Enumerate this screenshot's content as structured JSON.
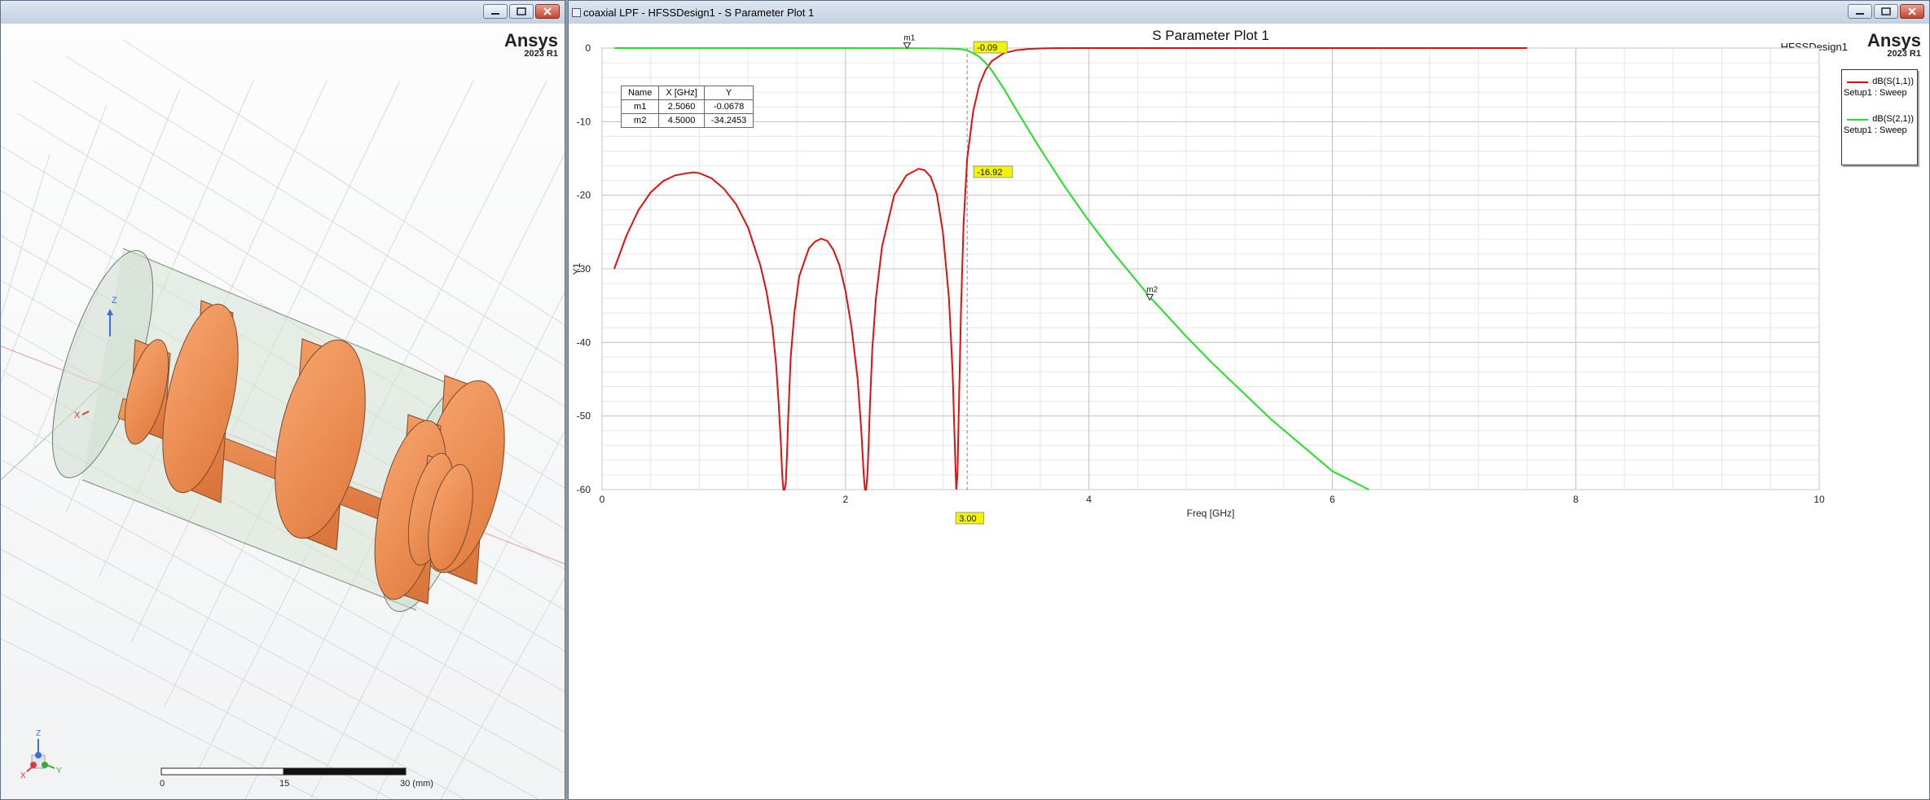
{
  "left_window": {
    "brand": "Ansys",
    "version": "2023 R1",
    "axis_triad": {
      "z": "Z",
      "x": "X",
      "y": "Y"
    },
    "scale_bar": {
      "labels": [
        "0",
        "15",
        "30 (mm)"
      ]
    },
    "model_axis_labels": {
      "z": "Z",
      "x": "X"
    },
    "colors": {
      "body": "#ef8c52",
      "air": "#d6e3d6",
      "grid": "#d0d4d8"
    }
  },
  "right_window": {
    "title": "coaxial LPF - HFSSDesign1 - S Parameter Plot 1",
    "brand": "Ansys",
    "version": "2023 R1",
    "design_name": "HFSSDesign1",
    "marker_table": {
      "headers": [
        "Name",
        "X [GHz]",
        "Y"
      ],
      "rows": [
        [
          "m1",
          "2.5060",
          "-0.0678"
        ],
        [
          "m2",
          "4.5000",
          "-34.2453"
        ]
      ]
    },
    "legend": [
      {
        "line1": "dB(S(1,1))",
        "line2": "Setup1 : Sweep",
        "color": "#e01010"
      },
      {
        "line1": "dB(S(2,1))",
        "line2": "Setup1 : Sweep",
        "color": "#22e022"
      }
    ],
    "cursor_labels": {
      "x_value": "3.00",
      "s21_value": "-0.09",
      "s11_value": "-16.92"
    },
    "markers": [
      {
        "name": "m1",
        "x": 2.506,
        "y": -0.0678
      },
      {
        "name": "m2",
        "x": 4.5,
        "y": -34.2453
      }
    ]
  },
  "chart_data": {
    "type": "line",
    "title": "S Parameter Plot 1",
    "xlabel": "Freq [GHz]",
    "ylabel": "Y1",
    "xlim": [
      0,
      10
    ],
    "ylim": [
      -60,
      0
    ],
    "xticks": [
      "0",
      "2",
      "4",
      "6",
      "8",
      "10"
    ],
    "yticks": [
      "0",
      "-10",
      "-20",
      "-30",
      "-40",
      "-50",
      "-60"
    ],
    "grid": true,
    "legend_position": "top-right",
    "series": [
      {
        "name": "dB(S(1,1))",
        "color": "#e01010",
        "x": [
          0.1,
          0.2,
          0.3,
          0.4,
          0.5,
          0.6,
          0.7,
          0.75,
          0.8,
          0.9,
          1.0,
          1.1,
          1.2,
          1.3,
          1.35,
          1.4,
          1.43,
          1.45,
          1.47,
          1.48,
          1.49,
          1.5,
          1.51,
          1.52,
          1.53,
          1.55,
          1.58,
          1.62,
          1.7,
          1.75,
          1.8,
          1.85,
          1.9,
          1.95,
          2.0,
          2.05,
          2.1,
          2.13,
          2.15,
          2.16,
          2.17,
          2.18,
          2.19,
          2.2,
          2.22,
          2.25,
          2.3,
          2.4,
          2.5,
          2.6,
          2.65,
          2.7,
          2.75,
          2.8,
          2.85,
          2.88,
          2.9,
          2.91,
          2.92,
          2.93,
          2.95,
          2.97,
          3.0,
          3.05,
          3.1,
          3.15,
          3.2,
          3.3,
          3.4,
          3.5,
          3.6,
          3.7,
          4.0,
          5.0,
          6.0,
          7.0,
          7.6
        ],
        "y": [
          -30,
          -25.5,
          -22,
          -19.6,
          -18.1,
          -17.3,
          -17.0,
          -16.9,
          -17.0,
          -17.7,
          -19.1,
          -21.2,
          -24.4,
          -29.5,
          -33,
          -38,
          -43,
          -48,
          -54,
          -58,
          -60,
          -60,
          -59,
          -55,
          -50,
          -42,
          -36,
          -31,
          -27.2,
          -26.3,
          -25.9,
          -26.2,
          -27.4,
          -29.5,
          -33,
          -38,
          -45,
          -52,
          -58,
          -60,
          -60,
          -58,
          -54,
          -49,
          -41,
          -34,
          -27,
          -20,
          -17.3,
          -16.4,
          -16.6,
          -17.5,
          -19.8,
          -25,
          -34,
          -44,
          -55,
          -60,
          -58,
          -50,
          -35,
          -24,
          -15,
          -8.5,
          -5,
          -3,
          -1.8,
          -0.7,
          -0.3,
          -0.12,
          -0.05,
          -0.02,
          0,
          0,
          0,
          0,
          0
        ]
      },
      {
        "name": "dB(S(2,1))",
        "color": "#22e022",
        "x": [
          0.1,
          1.0,
          2.0,
          2.5,
          2.8,
          2.9,
          2.95,
          3.0,
          3.05,
          3.1,
          3.15,
          3.2,
          3.3,
          3.4,
          3.5,
          3.6,
          3.8,
          4.0,
          4.2,
          4.5,
          4.8,
          5.0,
          5.5,
          6.0,
          6.3
        ],
        "y": [
          0,
          0,
          0,
          -0.02,
          -0.05,
          -0.1,
          -0.15,
          -0.3,
          -0.7,
          -1.2,
          -2.0,
          -3.0,
          -5.5,
          -8.3,
          -11,
          -13.7,
          -18.8,
          -23.5,
          -27.8,
          -33.8,
          -39.2,
          -42.6,
          -50.5,
          -57.5,
          -60
        ]
      }
    ]
  }
}
